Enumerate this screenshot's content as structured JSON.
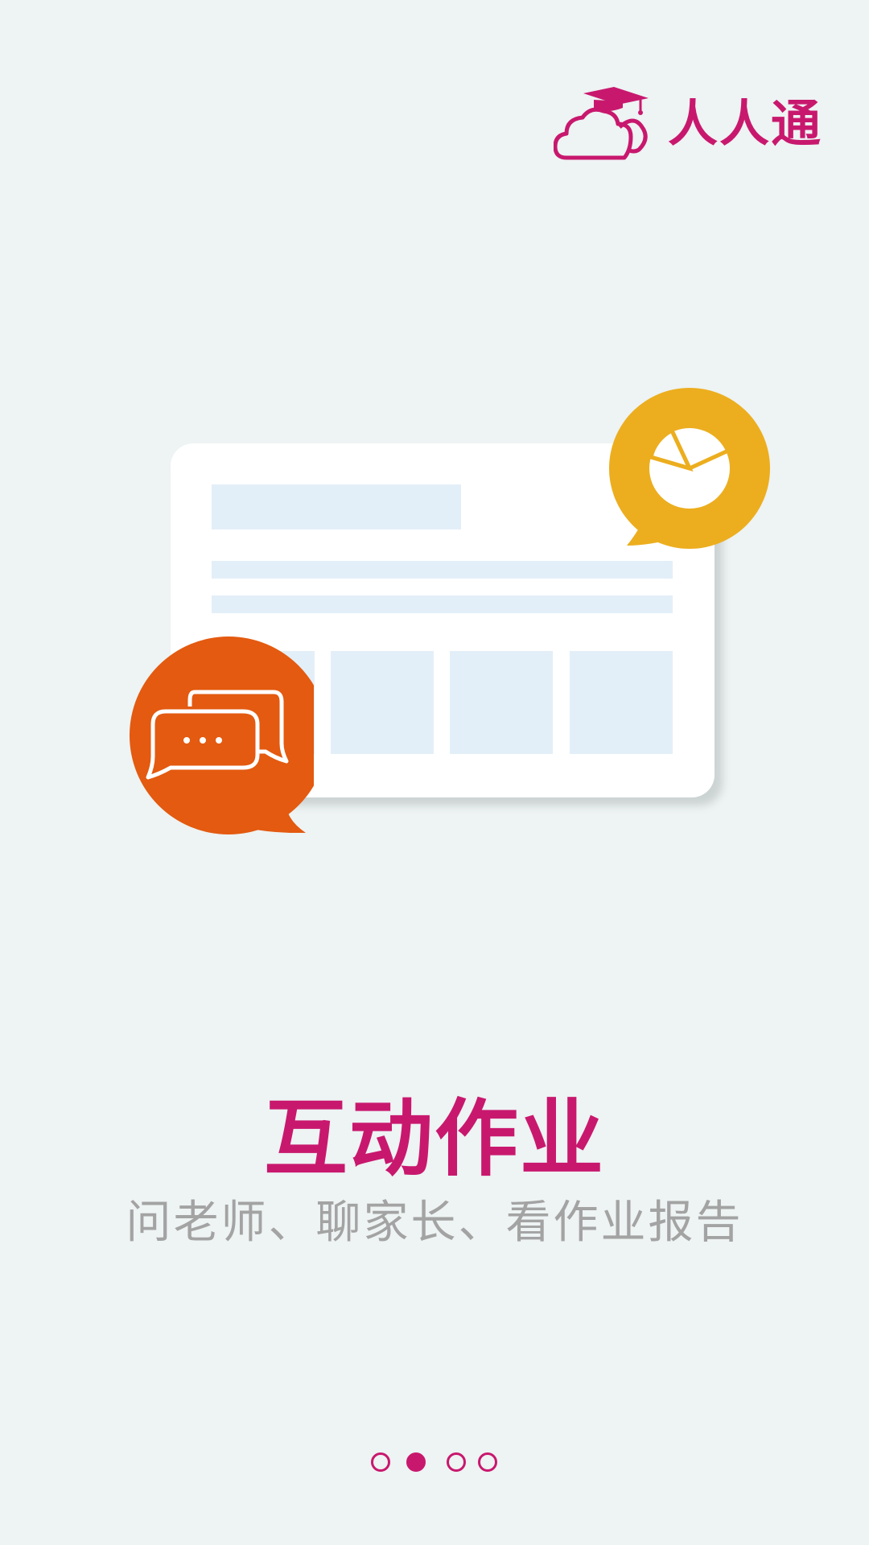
{
  "brand": {
    "name": "人人通",
    "color": "#c8186e"
  },
  "feature": {
    "title": "互动作业",
    "description": "问老师、聊家长、看作业报告"
  },
  "illustration": {
    "chat_bubble_color": "#e35a10",
    "chart_bubble_color": "#ecae1f",
    "card_block_color": "#e3eff8",
    "chat_icon": "chat-icon",
    "chart_icon": "pie-chart-icon"
  },
  "pager": {
    "total_pages": 4,
    "current_page": 2
  }
}
